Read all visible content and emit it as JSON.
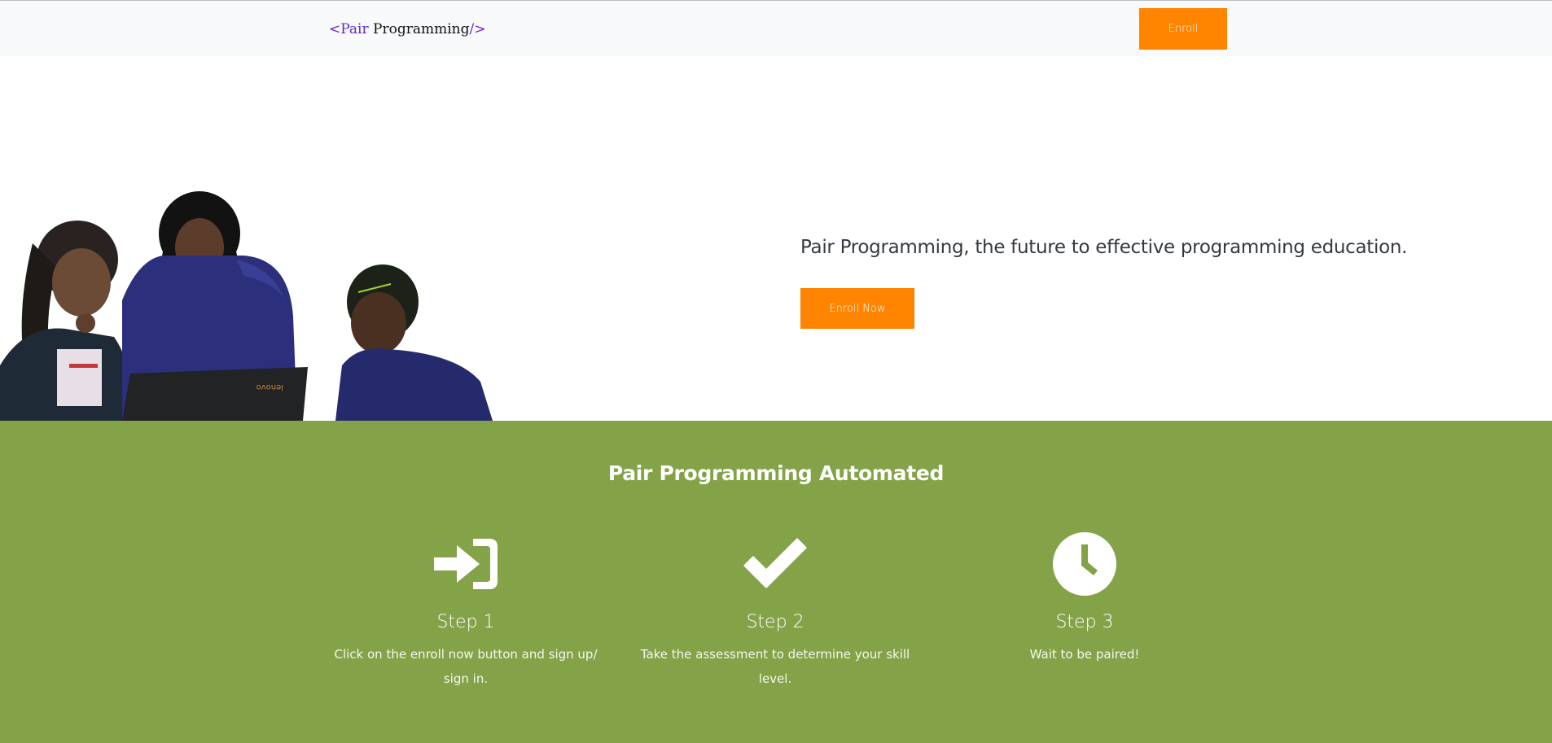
{
  "navbar": {
    "brand_open": "<",
    "brand_pair": "Pair",
    "brand_rest": " Programming",
    "brand_close_slash": "/",
    "brand_close": ">",
    "enroll_label": "Enroll"
  },
  "hero": {
    "title": "Pair Programming, the future to effective programming education.",
    "enroll_now_label": "Enroll Now",
    "image_name": "students-at-laptop-image",
    "laptop_brand": "lenovo"
  },
  "steps": {
    "title": "Pair Programming Automated",
    "items": [
      {
        "icon": "sign-in-icon",
        "label": "Step 1",
        "description": "Click on the enroll now button and sign up/ sign in."
      },
      {
        "icon": "checkmark-icon",
        "label": "Step 2",
        "description": "Take the assessment to determine your skill level."
      },
      {
        "icon": "clock-icon",
        "label": "Step 3",
        "description": "Wait to be paired!"
      }
    ]
  },
  "colors": {
    "accent": "#ff8500",
    "brand_tag": "#6f1fcf",
    "steps_bg": "#84a348",
    "navbar_bg": "#f8f9fa",
    "text_dark": "#343a40"
  }
}
